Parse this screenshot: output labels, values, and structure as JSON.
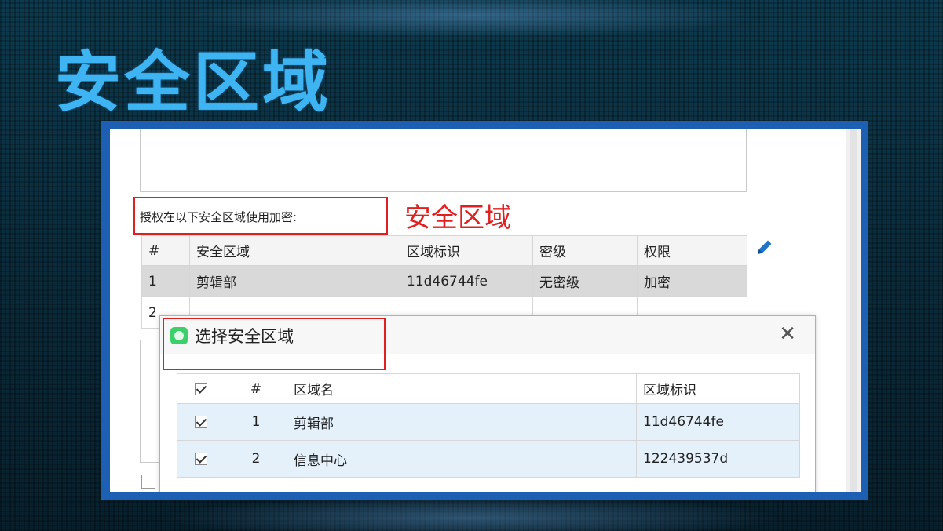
{
  "slide": {
    "title": "安全区域"
  },
  "window": {
    "auth_label": "授权在以下安全区域使用加密:",
    "annotation": "安全区域",
    "table": {
      "headers": [
        "#",
        "安全区域",
        "区域标识",
        "密级",
        "权限"
      ],
      "rows": [
        [
          "1",
          "剪辑部",
          "11d46744fe",
          "无密级",
          "加密"
        ],
        [
          "2",
          "",
          "",
          "",
          ""
        ]
      ]
    }
  },
  "dialog": {
    "title": "选择安全区域",
    "close_label": "✕",
    "table": {
      "headers": [
        "#",
        "区域名",
        "区域标识"
      ],
      "rows": [
        {
          "checked": true,
          "num": "1",
          "name": "剪辑部",
          "id": "11d46744fe"
        },
        {
          "checked": true,
          "num": "2",
          "name": "信息中心",
          "id": "122439537d"
        }
      ]
    }
  },
  "colors": {
    "title": "#3fb4f2",
    "annotation_red": "#e02020",
    "frame_blue": "#1c5fb3",
    "row_highlight": "#e4f0fa"
  },
  "icons": [
    "edit-pencil-icon",
    "app-icon",
    "close-icon",
    "checkbox-checked-icon"
  ]
}
